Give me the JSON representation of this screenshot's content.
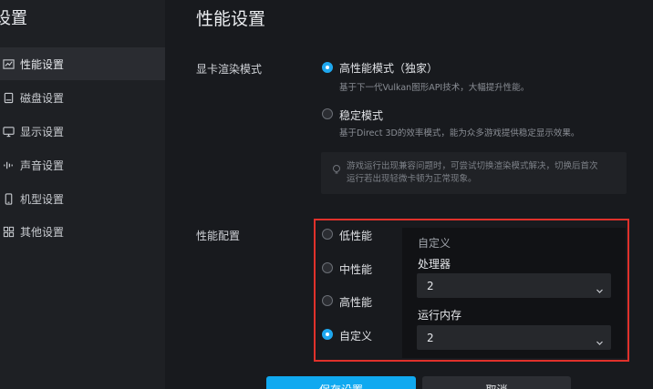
{
  "sidebar": {
    "title": "设置",
    "items": [
      {
        "label": "性能设置",
        "icon": "chart-icon"
      },
      {
        "label": "磁盘设置",
        "icon": "disk-icon"
      },
      {
        "label": "显示设置",
        "icon": "monitor-icon"
      },
      {
        "label": "声音设置",
        "icon": "sound-icon"
      },
      {
        "label": "机型设置",
        "icon": "phone-icon"
      },
      {
        "label": "其他设置",
        "icon": "grid-icon"
      }
    ],
    "active_index": 0
  },
  "main": {
    "title": "性能设置",
    "render_mode": {
      "label": "显卡渲染模式",
      "options": [
        {
          "label": "高性能模式（独家）",
          "desc": "基于下一代Vulkan图形API技术，大幅提升性能。",
          "checked": true
        },
        {
          "label": "稳定模式",
          "desc": "基于Direct 3D的效率模式，能为众多游戏提供稳定显示效果。",
          "checked": false
        }
      ],
      "tip_line1": "游戏运行出现兼容问题时，可尝试切换渲染模式解决，切换后首次",
      "tip_line2": "运行若出现轻微卡顿为正常现象。"
    },
    "perf_config": {
      "label": "性能配置",
      "options": [
        {
          "label": "低性能",
          "checked": false
        },
        {
          "label": "中性能",
          "checked": false
        },
        {
          "label": "高性能",
          "checked": false
        },
        {
          "label": "自定义",
          "checked": true
        }
      ],
      "custom": {
        "title": "自定义",
        "cpu_label": "处理器",
        "cpu_value": "2",
        "ram_label": "运行内存",
        "ram_value": "2"
      }
    },
    "buttons": {
      "save": "保存设置",
      "cancel": "取消"
    }
  },
  "colors": {
    "accent": "#10a9f0",
    "highlight_border": "#e0312b",
    "background": "#181a1e",
    "sidebar": "#1e2024"
  }
}
